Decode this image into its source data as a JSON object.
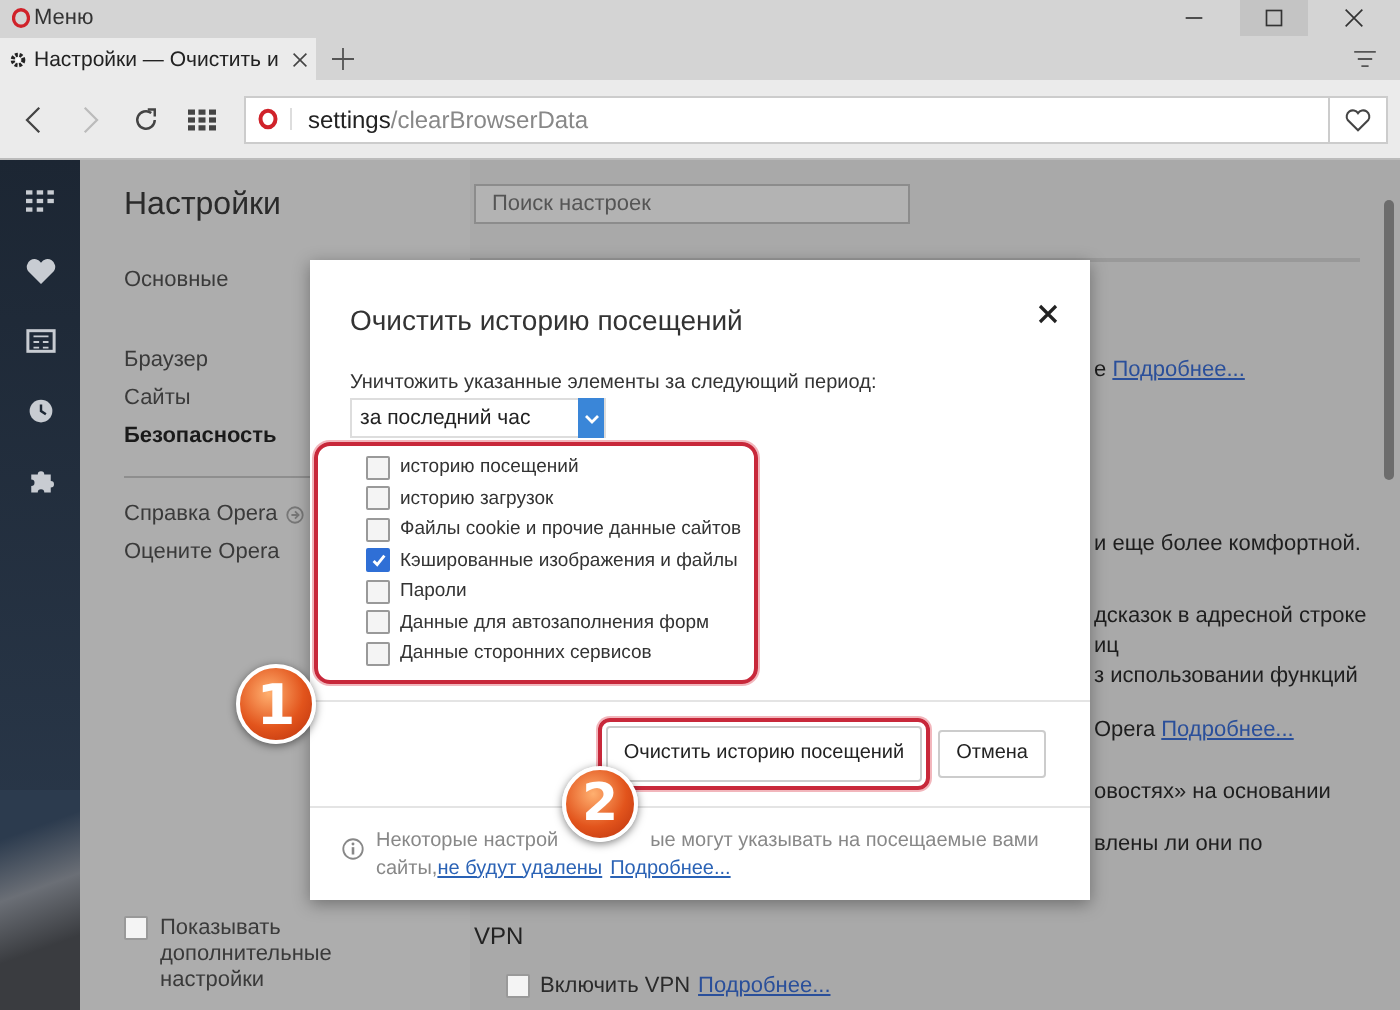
{
  "title_bar": {
    "menu_label": "Меню"
  },
  "tab": {
    "title": "Настройки — Очистить и",
    "selected": true
  },
  "address_bar": {
    "url_host": "settings",
    "url_path": "/clearBrowserData",
    "forward_disabled": true
  },
  "sidebar": {
    "title": "Настройки",
    "groups": [
      {
        "items": [
          {
            "label": "Основные",
            "selected": false,
            "kind": "page"
          }
        ]
      },
      {
        "items": [
          {
            "label": "Браузер",
            "selected": false,
            "kind": "page"
          },
          {
            "label": "Сайты",
            "selected": false,
            "kind": "page"
          },
          {
            "label": "Безопасность",
            "selected": true,
            "kind": "page"
          }
        ]
      },
      {
        "items": [
          {
            "label": "Справка Opera",
            "selected": false,
            "kind": "external"
          },
          {
            "label": "Оцените Opera",
            "selected": false,
            "kind": "page"
          }
        ]
      }
    ],
    "footer_checkbox": {
      "label": "Показывать дополнительные настройки",
      "checked": false
    }
  },
  "search": {
    "placeholder": "Поиск настроек"
  },
  "background_fragments": [
    {
      "text": "е ",
      "link": "Подробнее..."
    },
    {
      "text": "и еще более комфортной."
    },
    {
      "text": "дсказок в адресной строке"
    },
    {
      "text": "иц"
    },
    {
      "text": "з использовании функций"
    },
    {
      "text": "Opera ",
      "link": "Подробнее..."
    },
    {
      "text": "овостях» на основании"
    },
    {
      "text": "влены ли они по"
    }
  ],
  "vpn": {
    "heading": "VPN",
    "label": "Включить VPN",
    "checked": false,
    "link": "Подробнее..."
  },
  "dialog": {
    "title": "Очистить историю посещений",
    "period_label": "Уничтожить указанные элементы за следующий период:",
    "period_value": "за последний час",
    "items_highlighted": true,
    "items": [
      {
        "label": "историю посещений",
        "checked": false
      },
      {
        "label": "историю загрузок",
        "checked": false
      },
      {
        "label": "Файлы cookie и прочие данные сайтов",
        "checked": false
      },
      {
        "label": "Кэшированные изображения и файлы",
        "checked": true
      },
      {
        "label": "Пароли",
        "checked": false
      },
      {
        "label": "Данные для автозаполнения форм",
        "checked": false
      },
      {
        "label": "Данные сторонних сервисов",
        "checked": false
      }
    ],
    "buttons": [
      {
        "label": "Очистить историю посещений",
        "kind": "primary",
        "highlighted": true
      },
      {
        "label": "Отмена",
        "kind": "secondary",
        "highlighted": false
      }
    ],
    "note": {
      "line1_start": "Некоторые настрой",
      "line1_end": "ые могут указывать на посещаемые вами",
      "line2_text": "сайты, ",
      "links": [
        "не будут удалены",
        "Подробнее..."
      ]
    }
  },
  "annotations": [
    {
      "label": "1"
    },
    {
      "label": "2"
    }
  ]
}
